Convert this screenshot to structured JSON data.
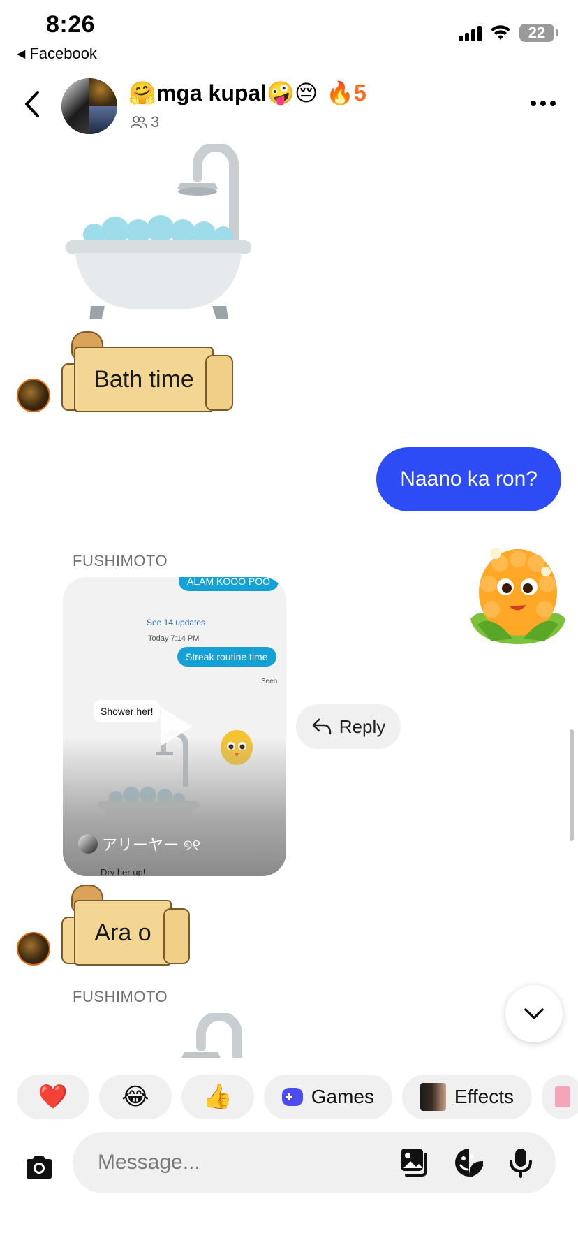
{
  "status_bar": {
    "time": "8:26",
    "back_app": "Facebook",
    "battery": "22"
  },
  "header": {
    "title_prefix_emoji": "🤗",
    "title": "mga kupal",
    "title_suffix_emoji": "🤪😔",
    "streak_emoji": "🔥",
    "streak_count": "5",
    "member_count": "3"
  },
  "messages": {
    "bath_sign": "Bath time",
    "outgoing": "Naano ka ron?",
    "sender_1": "FUSHIMOTO",
    "video": {
      "top_bubble": "ALAM KOOO POO",
      "see_updates": "See 14 updates",
      "timestamp": "Today 7:14 PM",
      "streak_bubble": "Streak routine time",
      "seen": "Seen",
      "shower_card": "Shower her!",
      "author": "アリーヤー ୭୧",
      "bottom_text": "Dry her up!"
    },
    "reply_label": "Reply",
    "ara_sign": "Ara o",
    "sender_2": "FUSHIMOTO"
  },
  "quick_reactions": {
    "heart": "❤️",
    "laugh": "😂",
    "thumbs": "👍",
    "games": "Games",
    "effects": "Effects"
  },
  "composer": {
    "placeholder": "Message..."
  }
}
